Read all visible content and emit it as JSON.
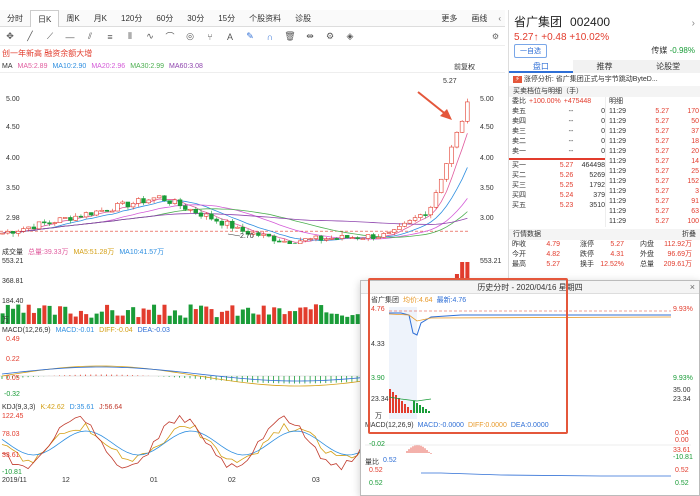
{
  "tabs": [
    "分时",
    "日K",
    "周K",
    "月K",
    "120分",
    "60分",
    "30分",
    "15分",
    "个股资料",
    "诊股"
  ],
  "tabs_right": {
    "more": "更多",
    "draw": "画线"
  },
  "info": {
    "line": "创一年新高  融资余额大增"
  },
  "ma_legend": {
    "ma": "MA",
    "ma5": "MA5:2.89",
    "ma10": "MA10:2.90",
    "ma20": "MA20:2.96",
    "ma30": "MA30:2.99",
    "ma60": "MA60:3.08",
    "fq": "前复权"
  },
  "colors": {
    "up": "#e23c2d",
    "down": "#1a9c38",
    "ma5": "#e05c9e",
    "ma10": "#2f8fe0",
    "ma20": "#d45bd8",
    "ma30": "#4caf50",
    "ma60": "#8e44ad",
    "arrow": "#e4573b"
  },
  "main_chart": {
    "y_ticks": [
      "5.00",
      "4.50",
      "4.00",
      "3.50",
      "2.98"
    ],
    "y_ticks_right": [
      "5.00",
      "4.50",
      "4.00",
      "3.50",
      "3.00"
    ],
    "high_label": "5.27",
    "low_label": "2.70"
  },
  "volume": {
    "label": "成交量",
    "total": "总量:39.33万",
    "ma5": "MA5:51.28万",
    "ma10": "MA10:41.57万",
    "ticks": [
      "553.21",
      "368.81",
      "184.40",
      "万"
    ],
    "right_top": "553.21"
  },
  "macd": {
    "label": "MACD(12,26,9)",
    "macd": "MACD:-0.01",
    "diff": "DIFF:-0.04",
    "dea": "DEA:-0.03",
    "ticks": [
      "0.49",
      "0.22",
      "0.05",
      "-0.32"
    ]
  },
  "kdj": {
    "label": "KDJ(9,3,3)",
    "k": "K:42.62",
    "d": "D:35.61",
    "j": "J:56.64",
    "ticks": [
      "122.45",
      "78.03",
      "33.61",
      "-10.81"
    ]
  },
  "x_axis": [
    "2019/11",
    "12",
    "01",
    "02",
    "03"
  ],
  "right": {
    "name": "省广集团",
    "code": "002400",
    "price": "5.27↑",
    "change": "+0.48",
    "pct": "+10.02%",
    "watch_btn": "一自选",
    "sector": "传媒",
    "sector_pct": "-0.98%",
    "tabs": [
      "盘口",
      "推荐",
      "论股堂"
    ],
    "news_label": "涨停分析:",
    "news_text": "省广集团正式与宇节跳动ByteD...",
    "bidask_title": "买卖档位与明细（手）",
    "wb_label": "委比",
    "wb": "+100.00%",
    "wb_extra": "+475448",
    "detail": "明细",
    "sells": [
      {
        "n": "卖五",
        "p": "--",
        "v": "0"
      },
      {
        "n": "卖四",
        "p": "--",
        "v": "0"
      },
      {
        "n": "卖三",
        "p": "--",
        "v": "0"
      },
      {
        "n": "卖二",
        "p": "--",
        "v": "0"
      },
      {
        "n": "卖一",
        "p": "--",
        "v": "0"
      }
    ],
    "buys": [
      {
        "n": "买一",
        "p": "5.27",
        "v": "464498"
      },
      {
        "n": "买二",
        "p": "5.26",
        "v": "5269"
      },
      {
        "n": "买三",
        "p": "5.25",
        "v": "1792"
      },
      {
        "n": "买四",
        "p": "5.24",
        "v": "379"
      },
      {
        "n": "买五",
        "p": "5.23",
        "v": "3510"
      }
    ],
    "ticks": [
      {
        "t": "11:29",
        "p": "5.27",
        "v": "170"
      },
      {
        "t": "11:29",
        "p": "5.27",
        "v": "50"
      },
      {
        "t": "11:29",
        "p": "5.27",
        "v": "37"
      },
      {
        "t": "11:29",
        "p": "5.27",
        "v": "18"
      },
      {
        "t": "11:29",
        "p": "5.27",
        "v": "20"
      },
      {
        "t": "11:29",
        "p": "5.27",
        "v": "14"
      },
      {
        "t": "11:29",
        "p": "5.27",
        "v": "25"
      },
      {
        "t": "11:29",
        "p": "5.27",
        "v": "152"
      },
      {
        "t": "11:29",
        "p": "5.27",
        "v": "3"
      },
      {
        "t": "11:29",
        "p": "5.27",
        "v": "91"
      },
      {
        "t": "11:29",
        "p": "5.27",
        "v": "63"
      },
      {
        "t": "11:29",
        "p": "5.27",
        "v": "100"
      }
    ],
    "quote_title": "行情数据",
    "quote_fold": "折叠",
    "quotes": [
      [
        "昨收",
        "4.79",
        "涨停",
        "5.27",
        "内盘",
        "112.92万"
      ],
      [
        "今开",
        "4.82",
        "跌停",
        "4.31",
        "外盘",
        "96.69万"
      ],
      [
        "最高",
        "5.27",
        "换手",
        "12.52%",
        "总量",
        "209.61万"
      ]
    ]
  },
  "popup": {
    "title": "历史分时 - 2020/04/16 星期四",
    "name": "省广集团",
    "avg": "均价:4.64",
    "latest": "最新:4.76",
    "y_left": [
      "4.76",
      "4.33",
      "3.90",
      "23.34",
      "万"
    ],
    "y_right": [
      "9.93%",
      "9.93%",
      "35.00",
      "23.34"
    ],
    "macd_label": "MACD(12,26,9)",
    "macd": "MACD:-0.0000",
    "diff": "DIFF:0.0000",
    "dea": "DEA:0.0000",
    "macd_right": [
      "0.04",
      "0.00"
    ],
    "macd_left": "-0.02",
    "kdj_right": [
      "33.61",
      "-10.81"
    ],
    "ratio_label": "量比",
    "ratio": "0.52",
    "ratio_left": [
      "0.52",
      "0.52"
    ],
    "ratio_right": [
      "0.52",
      "0.52"
    ]
  }
}
